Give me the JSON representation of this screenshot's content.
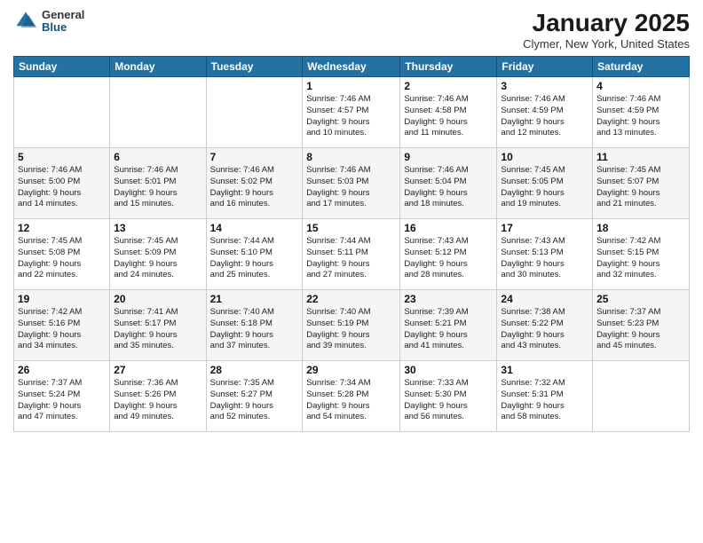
{
  "logo": {
    "general": "General",
    "blue": "Blue"
  },
  "header": {
    "title": "January 2025",
    "location": "Clymer, New York, United States"
  },
  "days_of_week": [
    "Sunday",
    "Monday",
    "Tuesday",
    "Wednesday",
    "Thursday",
    "Friday",
    "Saturday"
  ],
  "weeks": [
    [
      {
        "day": "",
        "detail": ""
      },
      {
        "day": "",
        "detail": ""
      },
      {
        "day": "",
        "detail": ""
      },
      {
        "day": "1",
        "detail": "Sunrise: 7:46 AM\nSunset: 4:57 PM\nDaylight: 9 hours\nand 10 minutes."
      },
      {
        "day": "2",
        "detail": "Sunrise: 7:46 AM\nSunset: 4:58 PM\nDaylight: 9 hours\nand 11 minutes."
      },
      {
        "day": "3",
        "detail": "Sunrise: 7:46 AM\nSunset: 4:59 PM\nDaylight: 9 hours\nand 12 minutes."
      },
      {
        "day": "4",
        "detail": "Sunrise: 7:46 AM\nSunset: 4:59 PM\nDaylight: 9 hours\nand 13 minutes."
      }
    ],
    [
      {
        "day": "5",
        "detail": "Sunrise: 7:46 AM\nSunset: 5:00 PM\nDaylight: 9 hours\nand 14 minutes."
      },
      {
        "day": "6",
        "detail": "Sunrise: 7:46 AM\nSunset: 5:01 PM\nDaylight: 9 hours\nand 15 minutes."
      },
      {
        "day": "7",
        "detail": "Sunrise: 7:46 AM\nSunset: 5:02 PM\nDaylight: 9 hours\nand 16 minutes."
      },
      {
        "day": "8",
        "detail": "Sunrise: 7:46 AM\nSunset: 5:03 PM\nDaylight: 9 hours\nand 17 minutes."
      },
      {
        "day": "9",
        "detail": "Sunrise: 7:46 AM\nSunset: 5:04 PM\nDaylight: 9 hours\nand 18 minutes."
      },
      {
        "day": "10",
        "detail": "Sunrise: 7:45 AM\nSunset: 5:05 PM\nDaylight: 9 hours\nand 19 minutes."
      },
      {
        "day": "11",
        "detail": "Sunrise: 7:45 AM\nSunset: 5:07 PM\nDaylight: 9 hours\nand 21 minutes."
      }
    ],
    [
      {
        "day": "12",
        "detail": "Sunrise: 7:45 AM\nSunset: 5:08 PM\nDaylight: 9 hours\nand 22 minutes."
      },
      {
        "day": "13",
        "detail": "Sunrise: 7:45 AM\nSunset: 5:09 PM\nDaylight: 9 hours\nand 24 minutes."
      },
      {
        "day": "14",
        "detail": "Sunrise: 7:44 AM\nSunset: 5:10 PM\nDaylight: 9 hours\nand 25 minutes."
      },
      {
        "day": "15",
        "detail": "Sunrise: 7:44 AM\nSunset: 5:11 PM\nDaylight: 9 hours\nand 27 minutes."
      },
      {
        "day": "16",
        "detail": "Sunrise: 7:43 AM\nSunset: 5:12 PM\nDaylight: 9 hours\nand 28 minutes."
      },
      {
        "day": "17",
        "detail": "Sunrise: 7:43 AM\nSunset: 5:13 PM\nDaylight: 9 hours\nand 30 minutes."
      },
      {
        "day": "18",
        "detail": "Sunrise: 7:42 AM\nSunset: 5:15 PM\nDaylight: 9 hours\nand 32 minutes."
      }
    ],
    [
      {
        "day": "19",
        "detail": "Sunrise: 7:42 AM\nSunset: 5:16 PM\nDaylight: 9 hours\nand 34 minutes."
      },
      {
        "day": "20",
        "detail": "Sunrise: 7:41 AM\nSunset: 5:17 PM\nDaylight: 9 hours\nand 35 minutes."
      },
      {
        "day": "21",
        "detail": "Sunrise: 7:40 AM\nSunset: 5:18 PM\nDaylight: 9 hours\nand 37 minutes."
      },
      {
        "day": "22",
        "detail": "Sunrise: 7:40 AM\nSunset: 5:19 PM\nDaylight: 9 hours\nand 39 minutes."
      },
      {
        "day": "23",
        "detail": "Sunrise: 7:39 AM\nSunset: 5:21 PM\nDaylight: 9 hours\nand 41 minutes."
      },
      {
        "day": "24",
        "detail": "Sunrise: 7:38 AM\nSunset: 5:22 PM\nDaylight: 9 hours\nand 43 minutes."
      },
      {
        "day": "25",
        "detail": "Sunrise: 7:37 AM\nSunset: 5:23 PM\nDaylight: 9 hours\nand 45 minutes."
      }
    ],
    [
      {
        "day": "26",
        "detail": "Sunrise: 7:37 AM\nSunset: 5:24 PM\nDaylight: 9 hours\nand 47 minutes."
      },
      {
        "day": "27",
        "detail": "Sunrise: 7:36 AM\nSunset: 5:26 PM\nDaylight: 9 hours\nand 49 minutes."
      },
      {
        "day": "28",
        "detail": "Sunrise: 7:35 AM\nSunset: 5:27 PM\nDaylight: 9 hours\nand 52 minutes."
      },
      {
        "day": "29",
        "detail": "Sunrise: 7:34 AM\nSunset: 5:28 PM\nDaylight: 9 hours\nand 54 minutes."
      },
      {
        "day": "30",
        "detail": "Sunrise: 7:33 AM\nSunset: 5:30 PM\nDaylight: 9 hours\nand 56 minutes."
      },
      {
        "day": "31",
        "detail": "Sunrise: 7:32 AM\nSunset: 5:31 PM\nDaylight: 9 hours\nand 58 minutes."
      },
      {
        "day": "",
        "detail": ""
      }
    ]
  ]
}
